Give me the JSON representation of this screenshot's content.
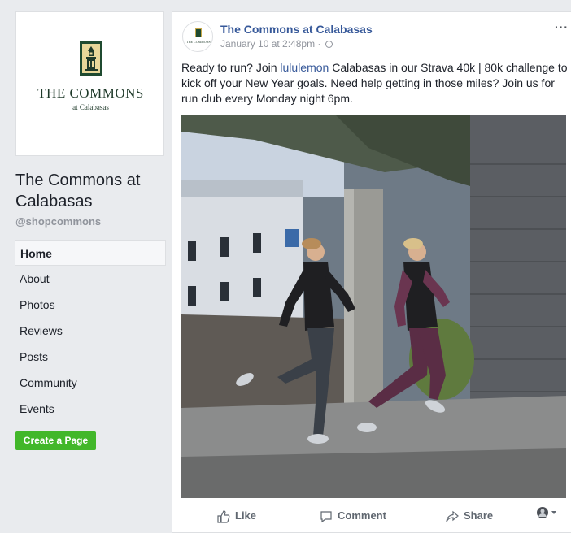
{
  "page": {
    "name": "The Commons at Calabasas",
    "handle": "@shopcommons",
    "logo_word": "THE COMMONS",
    "logo_sub": "at Calabasas"
  },
  "nav": {
    "items": [
      {
        "label": "Home",
        "active": true
      },
      {
        "label": "About"
      },
      {
        "label": "Photos"
      },
      {
        "label": "Reviews"
      },
      {
        "label": "Posts"
      },
      {
        "label": "Community"
      },
      {
        "label": "Events"
      }
    ]
  },
  "create_page_label": "Create a Page",
  "post": {
    "author": "The Commons at Calabasas",
    "timestamp": "January 10 at 2:48pm",
    "meta_separator": "·",
    "more": "···",
    "avatar_text": "THE COMMONS",
    "text_before": "Ready to run? Join ",
    "text_link": "lululemon",
    "text_after": " Calabasas in our Strava 40k | 80k challenge to kick off your New Year goals. Need help getting in those miles? Join us for run club every Monday night 6pm.",
    "image_icon": "photo-two-runners",
    "actions": {
      "like": "Like",
      "comment": "Comment",
      "share": "Share"
    }
  },
  "colors": {
    "link": "#365899",
    "create_button": "#42b72a",
    "page_background": "#e9ebee"
  }
}
